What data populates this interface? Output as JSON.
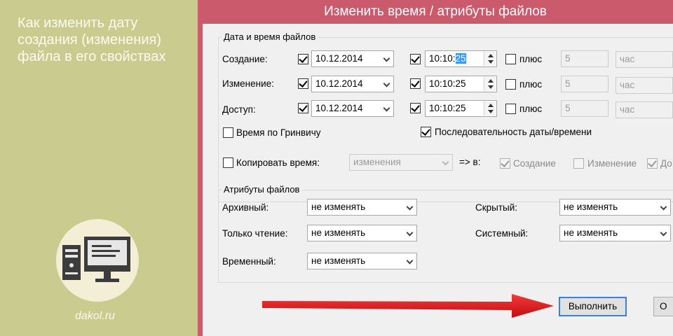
{
  "article": {
    "title": "Как изменить дату\nсоздания (изменения)\nфайла в его свойствах",
    "site": "dakol.ru"
  },
  "window": {
    "title": "Изменить время / атрибуты файлов"
  },
  "dates_group": {
    "legend": "Дата и время файлов",
    "rows": [
      {
        "label": "Создание:",
        "date_checked": true,
        "date": "10.12.2014",
        "time_checked": true,
        "time_prefix": "10:10:",
        "time_selected": "25",
        "plus_checked": false,
        "plus_label": "плюс",
        "amount": "5",
        "unit": "час"
      },
      {
        "label": "Изменение:",
        "date_checked": true,
        "date": "10.12.2014",
        "time_checked": true,
        "time_prefix": "10:10:25",
        "time_selected": "",
        "plus_checked": false,
        "plus_label": "плюс",
        "amount": "5",
        "unit": "час"
      },
      {
        "label": "Доступ:",
        "date_checked": true,
        "date": "10.12.2014",
        "time_checked": true,
        "time_prefix": "10:10:25",
        "time_selected": "",
        "plus_checked": false,
        "plus_label": "плюс",
        "amount": "5",
        "unit": "час"
      }
    ],
    "gmt": {
      "label": "Время по Гринвичу",
      "checked": false
    },
    "sequence": {
      "label": "Последовательность даты/времени",
      "checked": true
    },
    "copy_time": {
      "label": "Копировать время:",
      "checked": false,
      "source": "изменения",
      "arrow_label": "=> в:"
    },
    "copy_targets": [
      {
        "label": "Создание",
        "checked": true
      },
      {
        "label": "Изменение",
        "checked": false
      },
      {
        "label": "До",
        "checked": true
      }
    ]
  },
  "attributes_group": {
    "legend": "Атрибуты файлов",
    "items": [
      {
        "label": "Архивный:",
        "value": "не изменять"
      },
      {
        "label": "Только чтение:",
        "value": "не изменять"
      },
      {
        "label": "Временный:",
        "value": "не изменять"
      },
      {
        "label": "Скрытый:",
        "value": "не изменять"
      },
      {
        "label": "Системный:",
        "value": "не изменять"
      }
    ]
  },
  "buttons": {
    "run": "Выполнить",
    "cancel": "О"
  },
  "colors": {
    "left_panel": "#c9cc8e",
    "window_frame": "#cb5a6c",
    "arrow": "#e8141c"
  },
  "icons": [
    "computer-monitor-icon",
    "pc-tower-icon"
  ]
}
